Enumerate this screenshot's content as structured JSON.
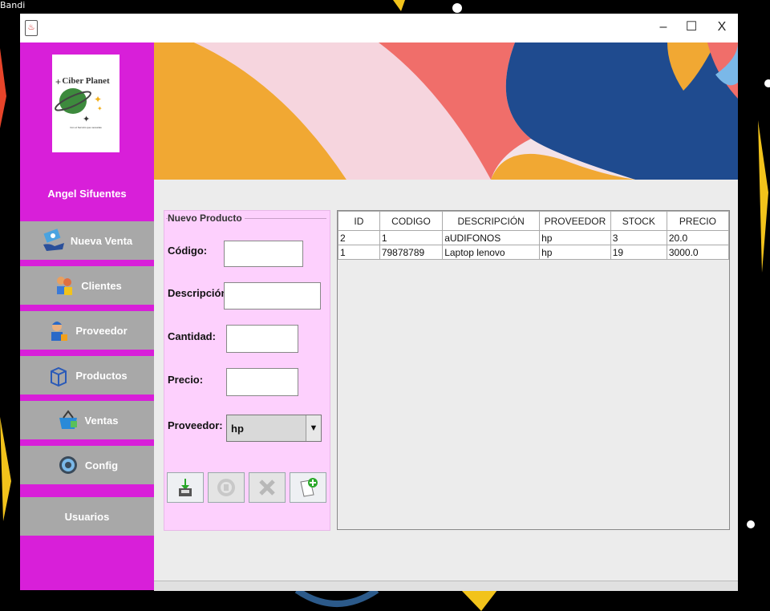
{
  "desktop": {
    "label": "Bandi"
  },
  "window": {
    "icon": "java-icon",
    "minimize": "–",
    "maximize": "☐",
    "close": "X"
  },
  "sidebar": {
    "logo_text": "Ciber Planet",
    "logo_tagline": "Con el Servicio que necesitas",
    "user_name": "Angel Sifuentes",
    "items": [
      {
        "label": "Nueva Venta",
        "icon": "cash-hand-icon"
      },
      {
        "label": "Clientes",
        "icon": "customers-icon"
      },
      {
        "label": "Proveedor",
        "icon": "supplier-icon"
      },
      {
        "label": "Productos",
        "icon": "box-icon"
      },
      {
        "label": "Ventas",
        "icon": "basket-icon"
      },
      {
        "label": "Config",
        "icon": "gear-icon"
      },
      {
        "label": "Usuarios",
        "icon": ""
      }
    ]
  },
  "form": {
    "title": "Nuevo Producto",
    "codigo_label": "Código:",
    "codigo_value": "",
    "descripcion_label": "Descripción:",
    "descripcion_value": "",
    "cantidad_label": "Cantidad:",
    "cantidad_value": "",
    "precio_label": "Precio:",
    "precio_value": "",
    "proveedor_label": "Proveedor:",
    "proveedor_value": "hp",
    "buttons": [
      "save-icon",
      "refresh-icon",
      "delete-icon",
      "new-document-icon"
    ]
  },
  "table": {
    "columns": [
      "ID",
      "CODIGO",
      "DESCRIPCIÓN",
      "PROVEEDOR",
      "STOCK",
      "PRECIO"
    ],
    "rows": [
      [
        "2",
        "1",
        "aUDIFONOS",
        "hp",
        "3",
        "20.0"
      ],
      [
        "1",
        "79878789",
        "Laptop lenovo",
        "hp",
        "19",
        "3000.0"
      ]
    ]
  },
  "colors": {
    "sidebar": "#d81fd9",
    "nav_button": "#a8a8a8",
    "form_panel": "#fdd0fd"
  }
}
